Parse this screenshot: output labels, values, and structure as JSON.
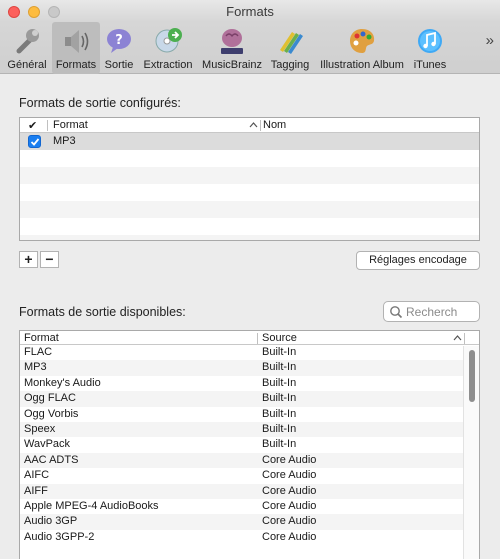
{
  "window": {
    "title": "Formats"
  },
  "toolbar": {
    "items": [
      {
        "label": "Général",
        "icon": "wrench-icon"
      },
      {
        "label": "Formats",
        "icon": "speaker-icon"
      },
      {
        "label": "Sortie",
        "icon": "question-bubble-icon"
      },
      {
        "label": "Extraction",
        "icon": "disc-extract-icon"
      },
      {
        "label": "MusicBrainz",
        "icon": "musicbrainz-icon"
      },
      {
        "label": "Tagging",
        "icon": "crayons-icon"
      },
      {
        "label": "Illustration Album",
        "icon": "palette-icon"
      },
      {
        "label": "iTunes",
        "icon": "itunes-icon"
      }
    ],
    "selected": "Formats",
    "overflow": "»"
  },
  "configured": {
    "title": "Formats de sortie configurés:",
    "headers": {
      "check": "✔",
      "format": "Format",
      "name": "Nom"
    },
    "rows": [
      {
        "checked": true,
        "format": "MP3",
        "name": ""
      }
    ],
    "add_label": "+",
    "remove_label": "−",
    "encode_settings_label": "Réglages encodage"
  },
  "available": {
    "title": "Formats de sortie disponibles:",
    "search_placeholder": "Recherch",
    "headers": {
      "format": "Format",
      "source": "Source"
    },
    "rows": [
      {
        "format": "FLAC",
        "source": "Built-In"
      },
      {
        "format": "MP3",
        "source": "Built-In"
      },
      {
        "format": "Monkey's Audio",
        "source": "Built-In"
      },
      {
        "format": "Ogg FLAC",
        "source": "Built-In"
      },
      {
        "format": "Ogg Vorbis",
        "source": "Built-In"
      },
      {
        "format": "Speex",
        "source": "Built-In"
      },
      {
        "format": "WavPack",
        "source": "Built-In"
      },
      {
        "format": "AAC ADTS",
        "source": "Core Audio"
      },
      {
        "format": "AIFC",
        "source": "Core Audio"
      },
      {
        "format": "AIFF",
        "source": "Core Audio"
      },
      {
        "format": "Apple MPEG-4 AudioBooks",
        "source": "Core Audio"
      },
      {
        "format": "Audio 3GP",
        "source": "Core Audio"
      },
      {
        "format": "Audio 3GPP-2",
        "source": "Core Audio"
      }
    ]
  },
  "colors": {
    "accent": "#1a7ef0",
    "window_bg": "#ececec"
  }
}
